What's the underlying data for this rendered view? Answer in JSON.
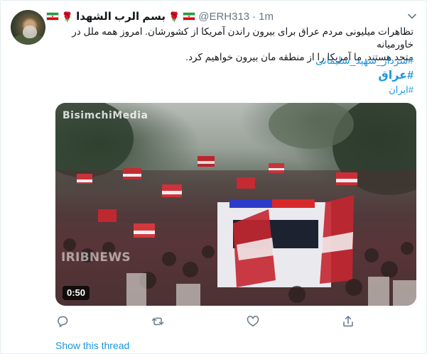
{
  "tweet": {
    "display_name": "بسم الرب الشهدا",
    "handle": "@ERH313",
    "separator": "·",
    "time": "1m",
    "text_line1": "تظاهرات میلیونی مردم عراق برای بیرون راندن آمریکا از کشورشان. امروز همه ملل در خاورمیانه",
    "text_line2": "متحد هستند. ما آمریکا را از منطقه مان بیرون خواهیم کرد.",
    "hashtags": [
      "#سردار_شهید_سلیمانی",
      "#عراق",
      "#ایران"
    ],
    "icons": {
      "more": "chevron-down-icon",
      "flag": "iran-flag-icon",
      "rose": "rose-icon"
    }
  },
  "media": {
    "watermark_top": "BisimchiMedia",
    "watermark_bottom": "IRIBNEWS",
    "duration": "0:50"
  },
  "actions": [
    "reply-icon",
    "retweet-icon",
    "like-icon",
    "share-icon"
  ],
  "thread_link": "Show this thread",
  "colors": {
    "link": "#1b95e0",
    "text": "#14171a",
    "muted": "#657786"
  }
}
